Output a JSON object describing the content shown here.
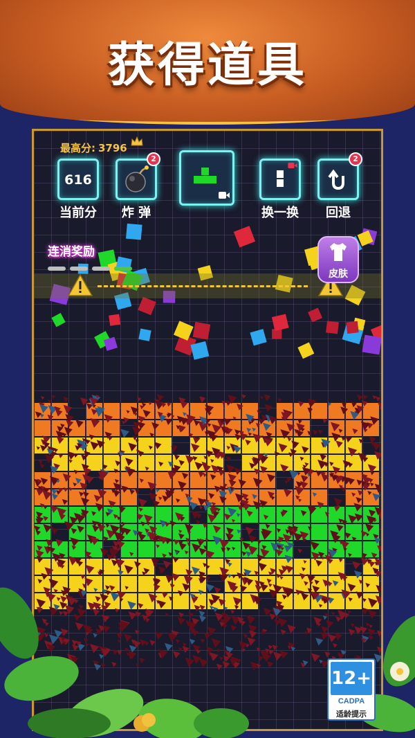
{
  "promo": {
    "title": "获得道具"
  },
  "hud": {
    "best_label": "最高分:",
    "best_value": "3796",
    "current_score": {
      "value": "616",
      "label": "当前分"
    },
    "bomb": {
      "label": "炸 弹",
      "badge": "2",
      "icon": "bomb-icon"
    },
    "next_piece": {
      "icon": "tetromino-t-icon",
      "ad_icon": "video-ad-icon",
      "piece_color": "#1fd82a"
    },
    "swap": {
      "label": "换一换",
      "icon": "swap-piece-icon",
      "ad_icon": "video-ad-icon"
    },
    "undo": {
      "label": "回退",
      "badge": "2",
      "icon": "undo-arrow-icon"
    }
  },
  "combo": {
    "label": "连消奖励",
    "segments": 4
  },
  "skin": {
    "label": "皮肤",
    "icon": "shirt-icon"
  },
  "rating": {
    "age": "12+",
    "org": "CADPA",
    "note": "适龄提示"
  },
  "colors": {
    "neon": "#7ff2f0",
    "gold": "#f6c445",
    "brick_rows": [
      "#f07a22",
      "#f07a22",
      "#f5d21c",
      "#f5d21c",
      "#f07a22",
      "#f07a22",
      "#1fd82a",
      "#1fd82a",
      "#1fd82a",
      "#f5d21c",
      "#f5d21c",
      "#f5d21c"
    ],
    "debris": "#7e1624"
  }
}
